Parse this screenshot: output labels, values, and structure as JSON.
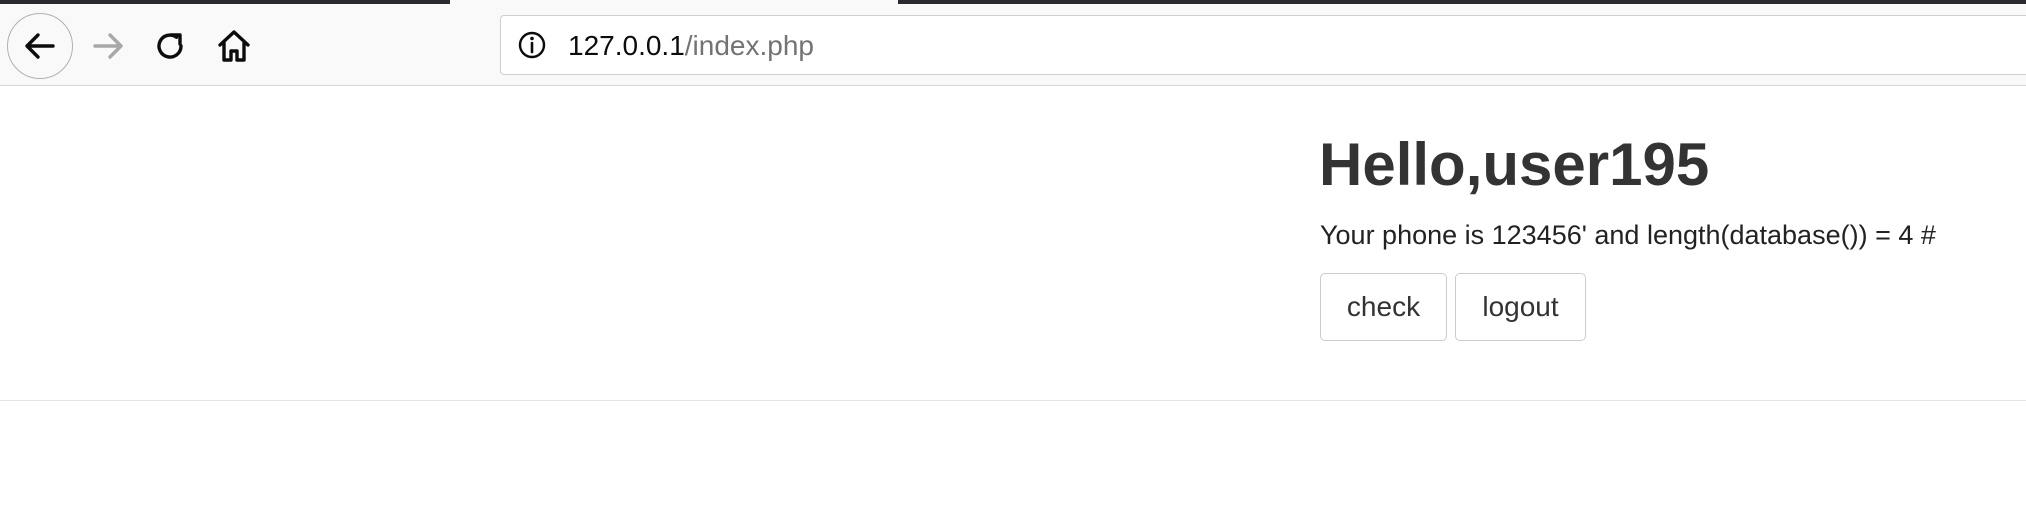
{
  "browser": {
    "url_host": "127.0.0.1",
    "url_path": "/index.php",
    "icons": {
      "back": "back-arrow-icon",
      "forward": "forward-arrow-icon",
      "reload": "reload-icon",
      "home": "home-icon",
      "site_info": "info-icon"
    }
  },
  "page": {
    "greeting": "Hello,user195",
    "phone_text": "Your phone is 123456' and length(database()) = 4 #",
    "buttons": {
      "check": "check",
      "logout": "logout"
    }
  }
}
